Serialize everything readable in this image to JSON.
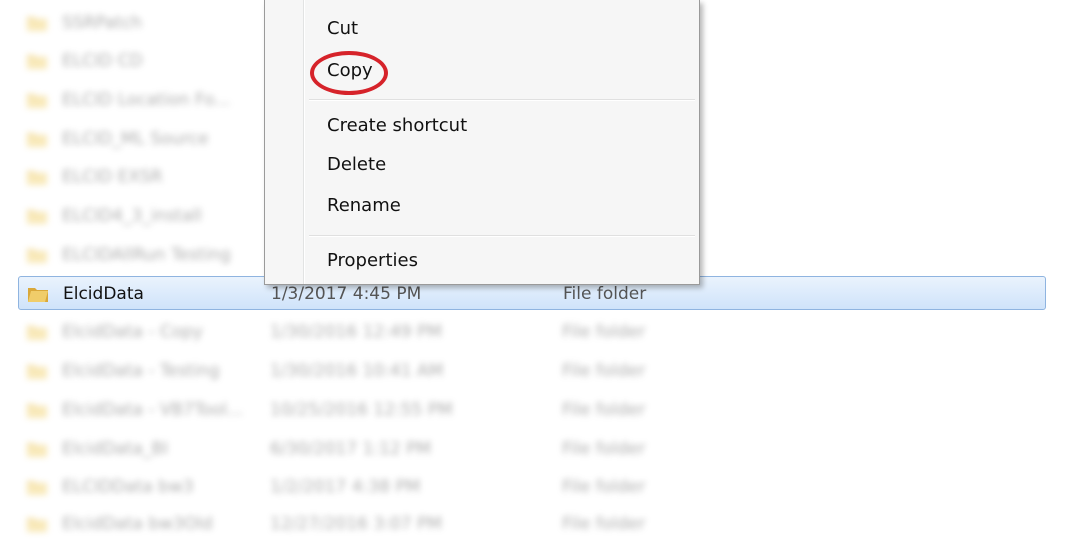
{
  "file_list": {
    "rows": [
      {
        "name": "SSRPatch",
        "date": "",
        "type": ""
      },
      {
        "name": "ELCID CD",
        "date": "",
        "type": ""
      },
      {
        "name": "ELCID Location Fo...",
        "date": "",
        "type": ""
      },
      {
        "name": "ELCID_ML Source",
        "date": "",
        "type": ""
      },
      {
        "name": "ELCID EXSR",
        "date": "",
        "type": ""
      },
      {
        "name": "ELCID4_3_install",
        "date": "",
        "type": ""
      },
      {
        "name": "ELCIDAllRun Testing",
        "date": "",
        "type": ""
      },
      {
        "name": "ElcidData",
        "date": "1/3/2017 4:45 PM",
        "type": "File folder"
      },
      {
        "name": "ElcidData - Copy",
        "date": "1/30/2016 12:49 PM",
        "type": "File folder"
      },
      {
        "name": "ElcidData - Testing",
        "date": "1/30/2016 10:41 AM",
        "type": "File folder"
      },
      {
        "name": "ElcidData - VB7Tool...",
        "date": "10/25/2016 12:55 PM",
        "type": "File folder"
      },
      {
        "name": "ElcidData_BI",
        "date": "6/30/2017 1:12 PM",
        "type": "File folder"
      },
      {
        "name": "ELCIDData bw3",
        "date": "1/2/2017 4:38 PM",
        "type": "File folder"
      },
      {
        "name": "ElcidData bw3Old",
        "date": "12/27/2016 3:07 PM",
        "type": "File folder"
      }
    ]
  },
  "context_menu": {
    "items": [
      {
        "label": "Cut"
      },
      {
        "label": "Copy"
      },
      {
        "label": "Create shortcut"
      },
      {
        "label": "Delete"
      },
      {
        "label": "Rename"
      },
      {
        "label": "Properties"
      }
    ]
  },
  "colors": {
    "highlight_circle": "#d6232a",
    "selection": "#cfe3fa"
  }
}
